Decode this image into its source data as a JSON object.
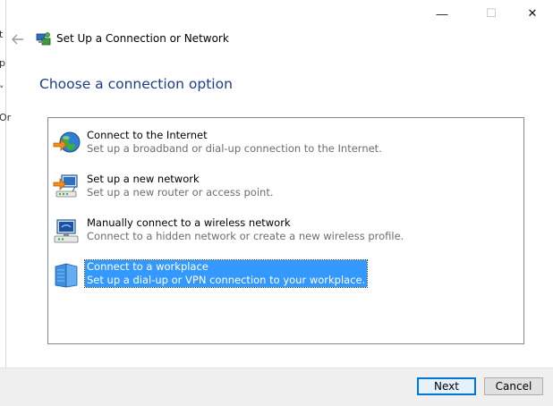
{
  "window": {
    "title": "Set Up a Connection or Network",
    "controls": {
      "minimize": "—",
      "maximize": "☐",
      "close": "✕"
    }
  },
  "background_fragments": [
    "t",
    "p",
    "˅",
    "Or"
  ],
  "heading": "Choose a connection option",
  "options": [
    {
      "title": "Connect to the Internet",
      "description": "Set up a broadband or dial-up connection to the Internet.",
      "icon": "globe-icon",
      "selected": false
    },
    {
      "title": "Set up a new network",
      "description": "Set up a new router or access point.",
      "icon": "router-icon",
      "selected": false
    },
    {
      "title": "Manually connect to a wireless network",
      "description": "Connect to a hidden network or create a new wireless profile.",
      "icon": "wireless-computer-icon",
      "selected": false
    },
    {
      "title": "Connect to a workplace",
      "description": "Set up a dial-up or VPN connection to your workplace.",
      "icon": "workplace-building-icon",
      "selected": true
    }
  ],
  "buttons": {
    "next": "Next",
    "cancel": "Cancel"
  },
  "colors": {
    "heading": "#1c3b8c",
    "selection": "#3399ff",
    "footer": "#f0f0f0"
  }
}
